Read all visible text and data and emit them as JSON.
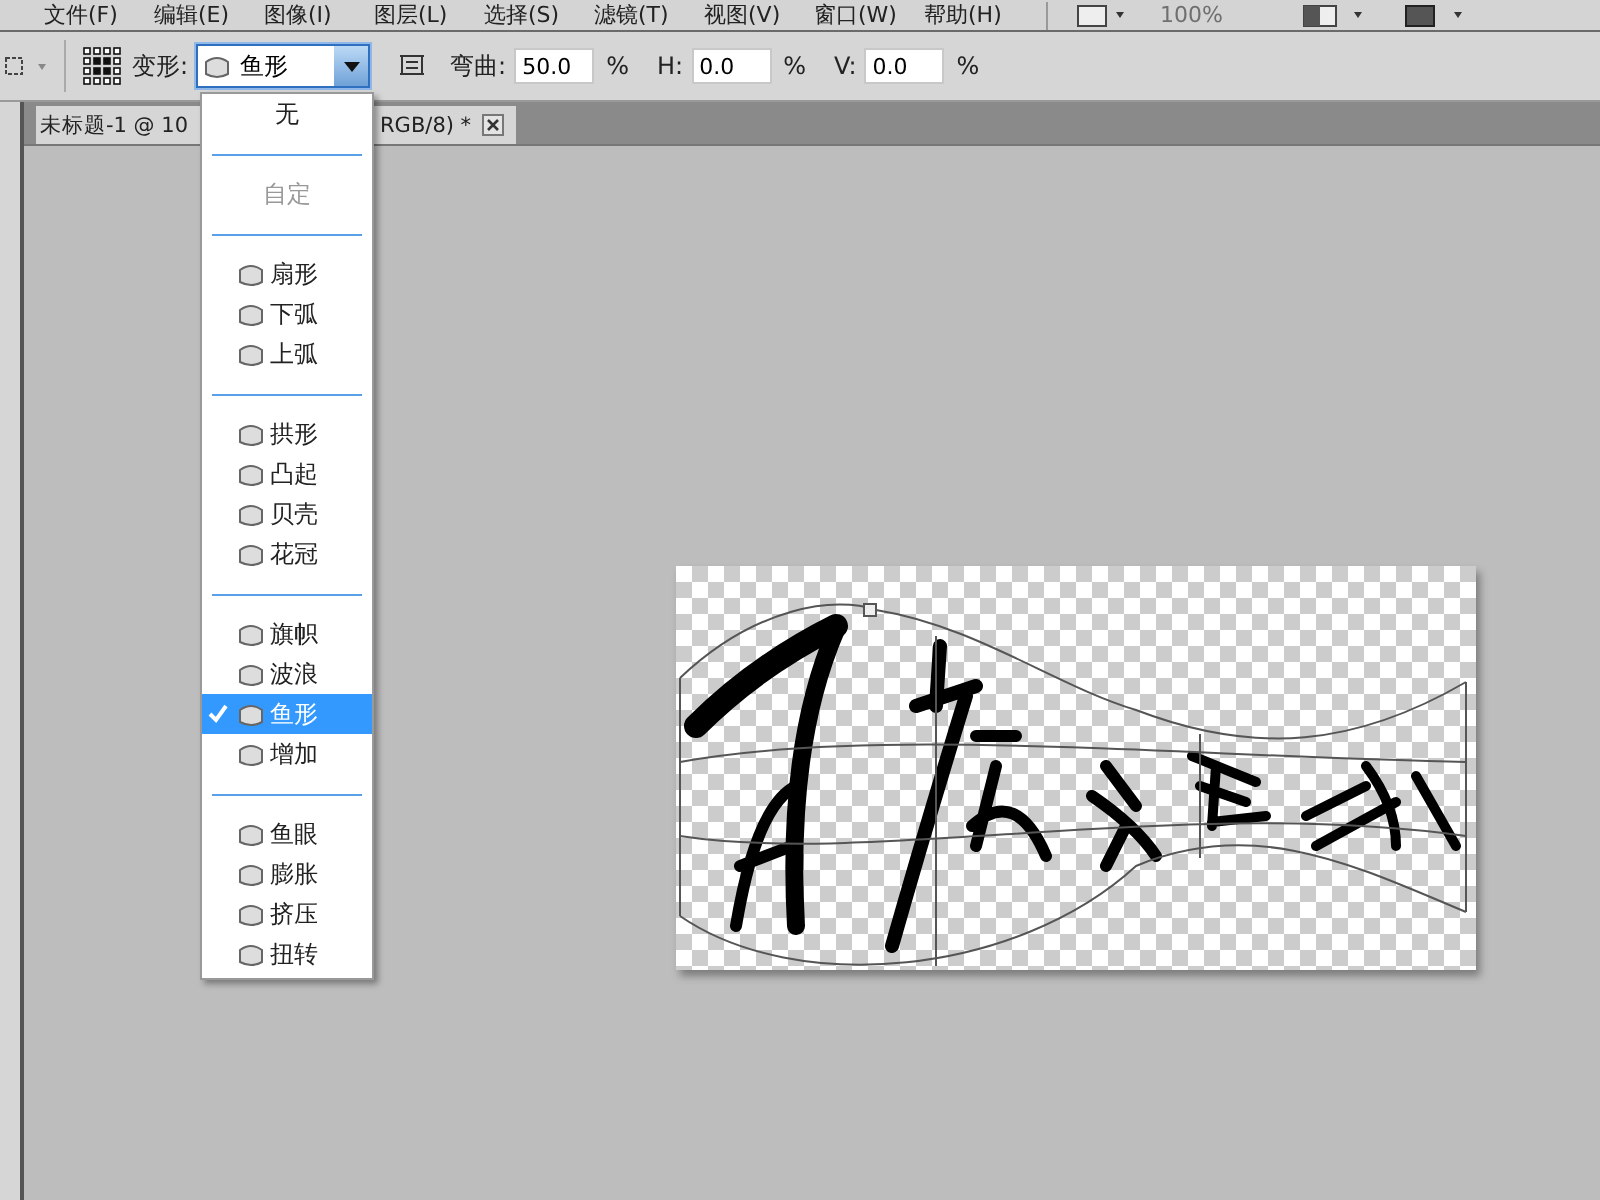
{
  "menu_bar": {
    "items": [
      "文件(F)",
      "编辑(E)",
      "图像(I)",
      "图层(L)",
      "选择(S)",
      "滤镜(T)",
      "视图(V)",
      "窗口(W)",
      "帮助(H)"
    ],
    "zoom": {
      "label": "100%",
      "disabled": true
    }
  },
  "options_bar": {
    "warp_label": "变形:",
    "warp_style": {
      "value": "鱼形",
      "expanded": true
    },
    "bend_label": "弯曲:",
    "bend": "50.0",
    "bend_unit": "%",
    "h_label": "H:",
    "h": "0.0",
    "h_unit": "%",
    "v_label": "V:",
    "v": "0.0",
    "v_unit": "%"
  },
  "document_tab": {
    "title_start": "未标题-1 @ 10",
    "title_end": "RGB/8) *"
  },
  "warp_menu": {
    "groups": [
      {
        "items": [
          {
            "label": "无",
            "kind": "plain",
            "selected": false,
            "disabled": false
          }
        ]
      },
      {
        "items": [
          {
            "label": "自定",
            "kind": "plain",
            "selected": false,
            "disabled": true
          }
        ]
      },
      {
        "items": [
          {
            "label": "扇形",
            "kind": "shape",
            "selected": false,
            "disabled": false
          },
          {
            "label": "下弧",
            "kind": "shape",
            "selected": false,
            "disabled": false
          },
          {
            "label": "上弧",
            "kind": "shape",
            "selected": false,
            "disabled": false
          }
        ]
      },
      {
        "items": [
          {
            "label": "拱形",
            "kind": "shape",
            "selected": false,
            "disabled": false
          },
          {
            "label": "凸起",
            "kind": "shape",
            "selected": false,
            "disabled": false
          },
          {
            "label": "贝壳",
            "kind": "shape",
            "selected": false,
            "disabled": false
          },
          {
            "label": "花冠",
            "kind": "shape",
            "selected": false,
            "disabled": false
          }
        ]
      },
      {
        "items": [
          {
            "label": "旗帜",
            "kind": "shape",
            "selected": false,
            "disabled": false
          },
          {
            "label": "波浪",
            "kind": "shape",
            "selected": false,
            "disabled": false
          },
          {
            "label": "鱼形",
            "kind": "shape",
            "selected": true,
            "disabled": false
          },
          {
            "label": "增加",
            "kind": "shape",
            "selected": false,
            "disabled": false
          }
        ]
      },
      {
        "items": [
          {
            "label": "鱼眼",
            "kind": "shape",
            "selected": false,
            "disabled": false
          },
          {
            "label": "膨胀",
            "kind": "shape",
            "selected": false,
            "disabled": false
          },
          {
            "label": "挤压",
            "kind": "shape",
            "selected": false,
            "disabled": false
          },
          {
            "label": "扭转",
            "kind": "shape",
            "selected": false,
            "disabled": false
          }
        ]
      }
    ]
  }
}
